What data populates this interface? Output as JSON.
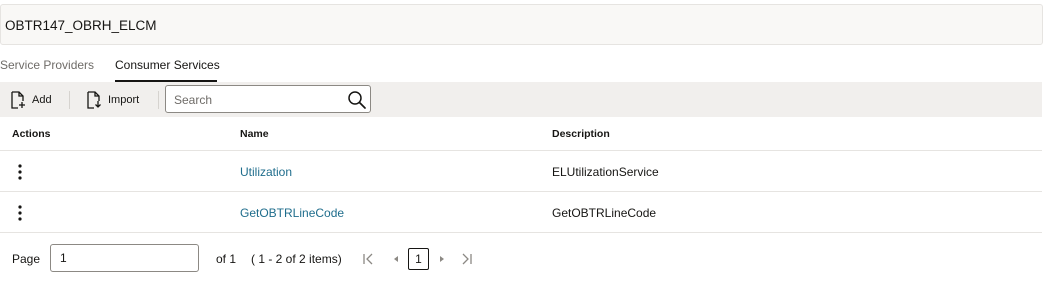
{
  "header": {
    "title": "OBTR147_OBRH_ELCM"
  },
  "tabs": [
    {
      "label": "Service Providers",
      "selected": false
    },
    {
      "label": "Consumer Services",
      "selected": true
    }
  ],
  "toolbar": {
    "add_label": "Add",
    "import_label": "Import",
    "search_placeholder": "Search"
  },
  "table": {
    "columns": [
      "Actions",
      "Name",
      "Description"
    ],
    "rows": [
      {
        "name": "Utilization",
        "description": "ELUtilizationService"
      },
      {
        "name": "GetOBTRLineCode",
        "description": "GetOBTRLineCode"
      }
    ]
  },
  "pagination": {
    "page_label": "Page",
    "page_value": "1",
    "of_label": "of 1",
    "range_text": "( 1 - 2 of 2 items)",
    "current_page": "1"
  },
  "colors": {
    "link": "#1f6d8c",
    "toolbar_bg": "#f1efed",
    "text": "#161513"
  },
  "icons": [
    "add-file-icon",
    "import-file-icon",
    "search-icon",
    "kebab-menu-icon",
    "first-page-icon",
    "prev-page-icon",
    "next-page-icon",
    "last-page-icon"
  ]
}
